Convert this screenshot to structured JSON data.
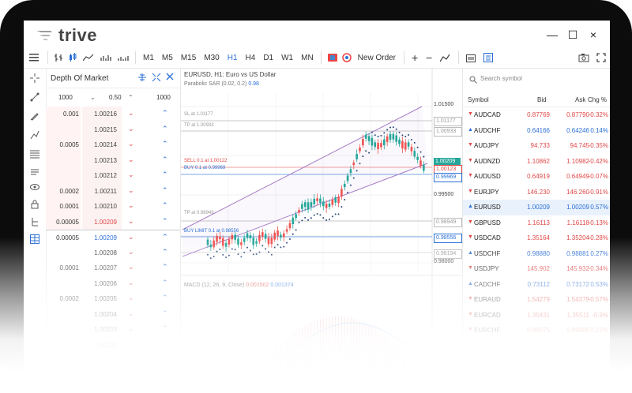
{
  "app": {
    "name": "trive"
  },
  "window_controls": {
    "close": "×",
    "minimize": "—",
    "maximize": "☐"
  },
  "toolbar": {
    "timeframes": [
      "M1",
      "M5",
      "M15",
      "M30",
      "H1",
      "H4",
      "D1",
      "W1",
      "MN"
    ],
    "active_timeframe": "H1",
    "new_order_label": "New Order",
    "zoom_in": "+",
    "zoom_out": "−"
  },
  "dom": {
    "title": "Depth Of Market",
    "volume_left": "1000",
    "step": "0.50",
    "volume_right": "1000",
    "rows": [
      {
        "vol": "0.001",
        "price": "1.00216",
        "side": "ask"
      },
      {
        "vol": "",
        "price": "1.00215",
        "side": "ask"
      },
      {
        "vol": "0.0005",
        "price": "1.00214",
        "side": "ask"
      },
      {
        "vol": "",
        "price": "1.00213",
        "side": "ask"
      },
      {
        "vol": "",
        "price": "1.00212",
        "side": "ask"
      },
      {
        "vol": "0.0002",
        "price": "1.00211",
        "side": "ask"
      },
      {
        "vol": "0.0001",
        "price": "1.00210",
        "side": "ask"
      },
      {
        "vol": "0.00005",
        "price": "1.00209",
        "side": "best_ask"
      },
      {
        "vol": "0.00005",
        "price": "1.00209",
        "side": "best_bid"
      },
      {
        "vol": "",
        "price": "1.00208",
        "side": "bid"
      },
      {
        "vol": "0.0001",
        "price": "1.00207",
        "side": "bid"
      },
      {
        "vol": "",
        "price": "1.00206",
        "side": "bid"
      },
      {
        "vol": "0.0002",
        "price": "1.00205",
        "side": "bid"
      },
      {
        "vol": "",
        "price": "1.00204",
        "side": "bid"
      },
      {
        "vol": "",
        "price": "1.00203",
        "side": "bid"
      },
      {
        "vol": "",
        "price": "1.00202",
        "side": "bid"
      }
    ]
  },
  "chart": {
    "title": "EURUSD, H1: Euro vs US Dollar",
    "sar_label": "Parabolic SAR (0.02, 0.2)",
    "sar_value": "0.98",
    "price_scale": [
      "1.01500",
      "1.01177",
      "1.00933",
      "1.00209",
      "1.00123",
      "0.99969",
      "0.99500",
      "0.98949",
      "0.98556",
      "0.98194",
      "0.98000"
    ],
    "order_lines": {
      "sl": "SL at 1.01177",
      "tp_top": "TP at 1.00933",
      "sell": "SELL 0.1 at 1.00122",
      "buy": "BUY 0.1 at 0.99969",
      "tp_bottom": "TP at 0.98949",
      "buy_limit": "BUY LIMIT 0.1 at 0.98556"
    },
    "macd_label": "MACD (12, 26, 9, Close)",
    "macd_value1": "0.001502",
    "macd_value2": "0.001374",
    "colors": {
      "up": "#26a69a",
      "down": "#ef5350",
      "channel": "#a67bc7",
      "sar": "#2c4a7a",
      "macd_line": "#6aa9e0",
      "hist": "#f29aa6"
    }
  },
  "watchlist": {
    "search_placeholder": "Search symbol",
    "headers": {
      "symbol": "Symbol",
      "bid": "Bid",
      "ask": "Ask",
      "chg": "Chg %"
    },
    "rows": [
      {
        "symbol": "AUDCAD",
        "bid": "0.87769",
        "ask": "0.87790",
        "chg": "-0.32%",
        "dir": "down"
      },
      {
        "symbol": "AUDCHF",
        "bid": "0.64166",
        "ask": "0.64246",
        "chg": "0.14%",
        "dir": "up"
      },
      {
        "symbol": "AUDJPY",
        "bid": "94.733",
        "ask": "94.745",
        "chg": "-0.35%",
        "dir": "down"
      },
      {
        "symbol": "AUDNZD",
        "bid": "1.10862",
        "ask": "1.10982",
        "chg": "-0.42%",
        "dir": "down"
      },
      {
        "symbol": "AUDUSD",
        "bid": "0.64919",
        "ask": "0.64949",
        "chg": "-0.07%",
        "dir": "down"
      },
      {
        "symbol": "EURJPY",
        "bid": "146.230",
        "ask": "146.260",
        "chg": "-0.91%",
        "dir": "down"
      },
      {
        "symbol": "EURUSD",
        "bid": "1.00209",
        "ask": "1.00209",
        "chg": "0.57%",
        "dir": "up",
        "selected": true
      },
      {
        "symbol": "GBPUSD",
        "bid": "1.16113",
        "ask": "1.16118",
        "chg": "-0.13%",
        "dir": "down"
      },
      {
        "symbol": "USDCAD",
        "bid": "1.35164",
        "ask": "1.35204",
        "chg": "-0.28%",
        "dir": "down"
      },
      {
        "symbol": "USDCHF",
        "bid": "0.98880",
        "ask": "0.98881",
        "chg": "0.27%",
        "dir": "up"
      },
      {
        "symbol": "USDJPY",
        "bid": "145.902",
        "ask": "145.932",
        "chg": "-0.34%",
        "dir": "down"
      },
      {
        "symbol": "CADCHF",
        "bid": "0.73112",
        "ask": "0.73172",
        "chg": "0.53%",
        "dir": "up"
      },
      {
        "symbol": "EURAUD",
        "bid": "1.54279",
        "ask": "1.54379",
        "chg": "-0.57%",
        "dir": "down"
      },
      {
        "symbol": "EURCAD",
        "bid": "1.35431",
        "ask": "1.35511",
        "chg": "-0.9%",
        "dir": "down"
      },
      {
        "symbol": "EURCHF",
        "bid": "0.99075",
        "ask": "0.99085",
        "chg": "-0.27%",
        "dir": "down"
      }
    ]
  }
}
